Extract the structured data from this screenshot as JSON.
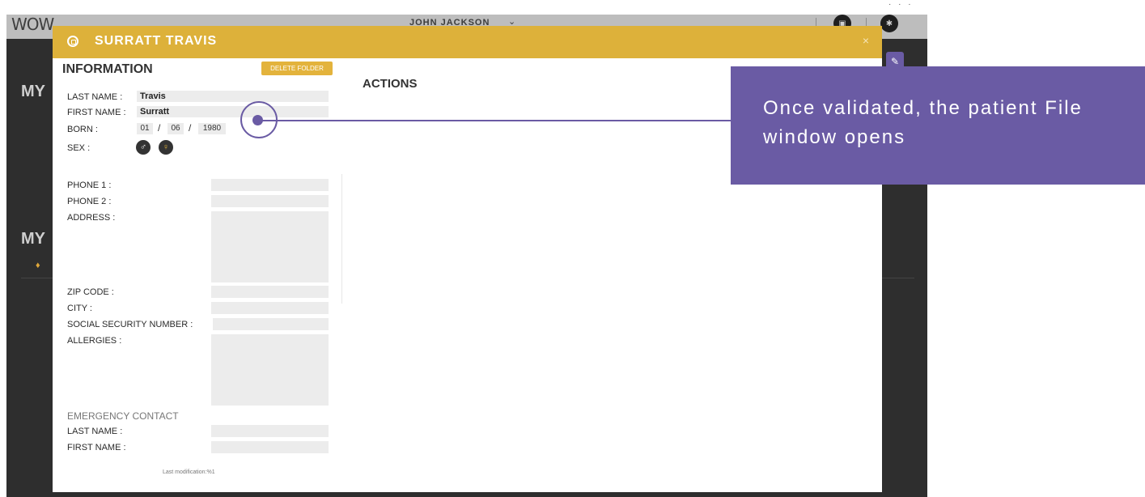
{
  "app": {
    "logo": "WOW",
    "user_name": "JOHN JACKSON",
    "user_chevron": "⌄",
    "corner_dots": "· · ·",
    "background_headings": [
      "MY",
      "MY"
    ]
  },
  "modal": {
    "title": "SURRATT TRAVIS",
    "close": "×",
    "information_title": "INFORMATION",
    "delete_button": "DELETE FOLDER",
    "actions_title": "ACTIONS",
    "fields": {
      "last_name_label": "LAST NAME :",
      "last_name_value": "Travis",
      "first_name_label": "FIRST NAME :",
      "first_name_value": "Surratt",
      "born_label": "BORN :",
      "born_day": "01",
      "born_month": "06",
      "born_year": "1980",
      "date_sep": "/",
      "sex_label": "SEX :",
      "phone1_label": "PHONE 1 :",
      "phone2_label": "PHONE 2 :",
      "address_label": "ADDRESS :",
      "zip_label": "ZIP CODE :",
      "city_label": "CITY :",
      "ssn_label": "SOCIAL SECURITY NUMBER :",
      "allergies_label": "ALLERGIES :",
      "emergency_title": "EMERGENCY CONTACT",
      "em_last_name_label": "LAST NAME :",
      "em_first_name_label": "FIRST NAME :"
    },
    "last_modification": "Last modification:%1"
  },
  "callout": {
    "text": "Once validated, the patient File window opens"
  },
  "colors": {
    "accent_gold": "#ddb13a",
    "callout_purple": "#6a5ba4",
    "app_dark": "#2e2e2e"
  }
}
